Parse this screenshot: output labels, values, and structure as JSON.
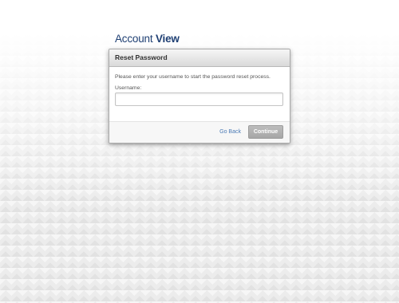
{
  "brand": {
    "part1": "Account",
    "part2": "View",
    "color": "#1e3f73"
  },
  "dialog": {
    "title": "Reset Password",
    "instructions": "Please enter your username to start the password reset process.",
    "username": {
      "label": "Username:",
      "value": ""
    },
    "go_back_label": "Go Back",
    "continue_label": "Continue"
  },
  "colors": {
    "link": "#4a7ab5",
    "button_disabled": "#b0b0b0"
  }
}
